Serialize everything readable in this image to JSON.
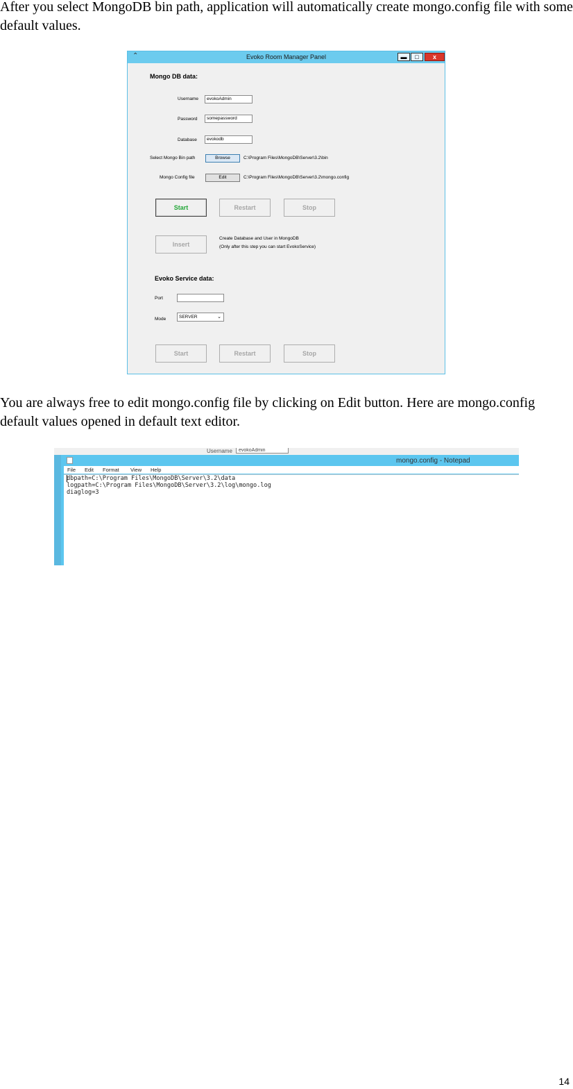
{
  "text": {
    "para1": "After you select MongoDB bin path, application will automatically create mongo.config file with some default values.",
    "para2": "You are always free to edit mongo.config file by clicking on Edit button. Here are mongo.config default values opened in default text editor.",
    "page_number": "14"
  },
  "evoko_window": {
    "title": "Evoko Room Manager Panel",
    "minimize": "▬",
    "maximize": "□",
    "close": "x",
    "mongo_section": "Mongo DB data:",
    "username_label": "Username",
    "username_value": "evokoAdmin",
    "password_label": "Password",
    "password_value": "somepassword",
    "database_label": "Database",
    "database_value": "evokodb",
    "bin_path_label": "Select Mongo Bin path",
    "browse_label": "Browse",
    "bin_path_value": "C:\\Program Files\\MongoDB\\Server\\3.2\\bin",
    "config_label": "Mongo Config file",
    "edit_label": "Edit",
    "config_value": "C:\\Program Files\\MongoDB\\Server\\3.2\\mongo.config",
    "start1": "Start",
    "restart1": "Restart",
    "stop1": "Stop",
    "insert": "Insert",
    "insert_note1": "Create Database and User in MongoDB",
    "insert_note2": "(Only after this step you can start EvokoService)",
    "evoko_section": "Evoko Service data:",
    "port_label": "Port",
    "port_value": "",
    "mode_label": "Mode",
    "mode_value": "SERVER",
    "start2": "Start",
    "restart2": "Restart",
    "stop2": "Stop"
  },
  "notepad": {
    "bg_username_label": "Username",
    "bg_username_value": "evokoAdmin",
    "title": "mongo.config - Notepad",
    "menu": [
      "File",
      "Edit",
      "Format",
      "View",
      "Help"
    ],
    "lines": [
      "dbpath=C:\\Program Files\\MongoDB\\Server\\3.2\\data",
      "logpath=C:\\Program Files\\MongoDB\\Server\\3.2\\log\\mongo.log",
      "diaglog=3"
    ]
  },
  "colors": {
    "titlebar": "#6ccbee",
    "start_active": "#22a637",
    "disabled_text": "#a6a6a6",
    "close_button": "#d9372b"
  }
}
